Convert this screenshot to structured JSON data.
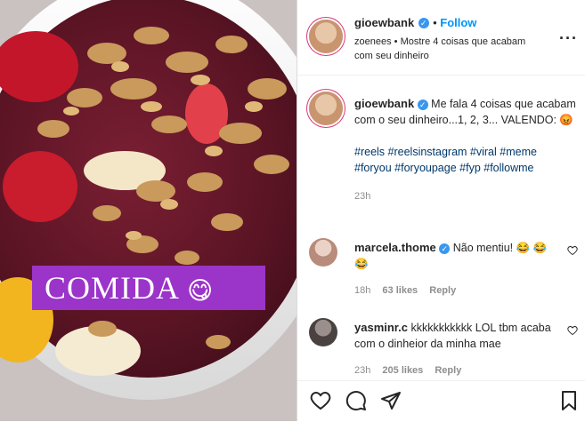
{
  "post": {
    "overlay_text": "COMIDA",
    "overlay_emoji": "😋"
  },
  "header": {
    "username": "gioewbank",
    "follow_label": "Follow",
    "location_user": "zoenees",
    "location_text": "Mostre 4 coisas que acabam com seu dinheiro"
  },
  "caption": {
    "username": "gioewbank",
    "text": "Me fala 4 coisas que acabam com o seu dinheiro...1, 2, 3... VALENDO: 😡",
    "hashtags": "#reels #reelsinstagram #viral #meme #foryou #foryoupage #fyp #followme",
    "time": "23h"
  },
  "comments": [
    {
      "username": "marcela.thome",
      "text": "Não mentiu! 😂 😂😂",
      "time": "18h",
      "likes": "63 likes",
      "reply": "Reply"
    },
    {
      "username": "yasminr.c",
      "text": "kkkkkkkkkkk LOL tbm acaba com o dinheior da minha mae",
      "time": "23h",
      "likes": "205 likes",
      "reply": "Reply"
    }
  ],
  "icons": [
    "heart-icon",
    "comment-icon",
    "share-icon",
    "bookmark-icon",
    "more-options-icon",
    "verified-icon"
  ]
}
